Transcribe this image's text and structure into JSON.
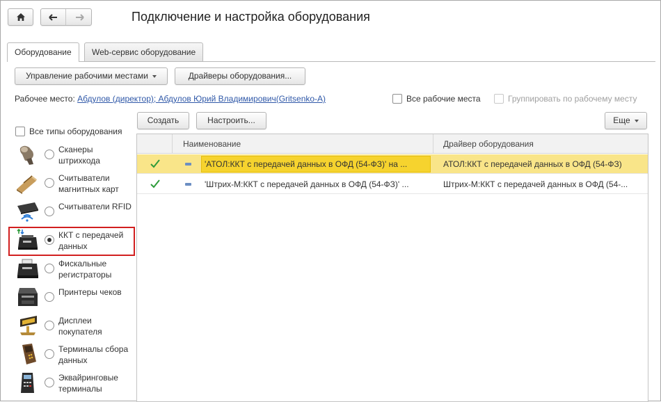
{
  "window": {
    "title": "Подключение и настройка оборудования"
  },
  "tabs": [
    {
      "label": "Оборудование",
      "active": true
    },
    {
      "label": "Web-сервис оборудование",
      "active": false
    }
  ],
  "toolbar": {
    "workplaces_button": "Управление рабочими местами",
    "drivers_button": "Драйверы оборудования..."
  },
  "workplace": {
    "label": "Рабочее место:",
    "value": "Абдулов (директор); Абдулов Юрий Владимирович(Gritsenko-A)"
  },
  "filters": {
    "all_workplaces": "Все рабочие места",
    "group_by_workplace": "Группировать по рабочему месту",
    "all_types": "Все типы оборудования"
  },
  "actions": {
    "create": "Создать",
    "configure": "Настроить...",
    "more": "Еще"
  },
  "equipment_types": [
    {
      "label": "Сканеры штрихкода",
      "icon": "barcode-scanner-icon",
      "selected": false
    },
    {
      "label": "Считыватели магнитных карт",
      "icon": "magnetic-card-reader-icon",
      "selected": false
    },
    {
      "label": "Считыватели RFID",
      "icon": "rfid-reader-icon",
      "selected": false
    },
    {
      "label": "ККТ с передачей данных",
      "icon": "online-cash-register-icon",
      "selected": true
    },
    {
      "label": "Фискальные регистраторы",
      "icon": "fiscal-registrar-icon",
      "selected": false
    },
    {
      "label": "Принтеры чеков",
      "icon": "receipt-printer-icon",
      "selected": false
    },
    {
      "label": "Дисплеи покупателя",
      "icon": "customer-display-icon",
      "selected": false
    },
    {
      "label": "Терминалы сбора данных",
      "icon": "data-terminal-icon",
      "selected": false
    },
    {
      "label": "Эквайринговые терминалы",
      "icon": "acquiring-terminal-icon",
      "selected": false
    }
  ],
  "grid": {
    "columns": [
      "Наименование",
      "Драйвер оборудования"
    ],
    "rows": [
      {
        "name": "'АТОЛ:ККТ с передачей данных в ОФД (54-ФЗ)' на ...",
        "driver": "АТОЛ:ККТ с передачей данных в ОФД (54-ФЗ)",
        "enabled": true,
        "selected": true
      },
      {
        "name": "'Штрих-М:ККТ с передачей данных в ОФД (54-ФЗ)' ...",
        "driver": "Штрих-М:ККТ с передачей данных в ОФД (54-...",
        "enabled": true,
        "selected": false
      }
    ]
  },
  "colors": {
    "selected_row": "#f9e589",
    "selected_cell": "#f6d32e",
    "link": "#2f58a8",
    "highlight": "#d21f1f",
    "check": "#2e9b3a"
  }
}
